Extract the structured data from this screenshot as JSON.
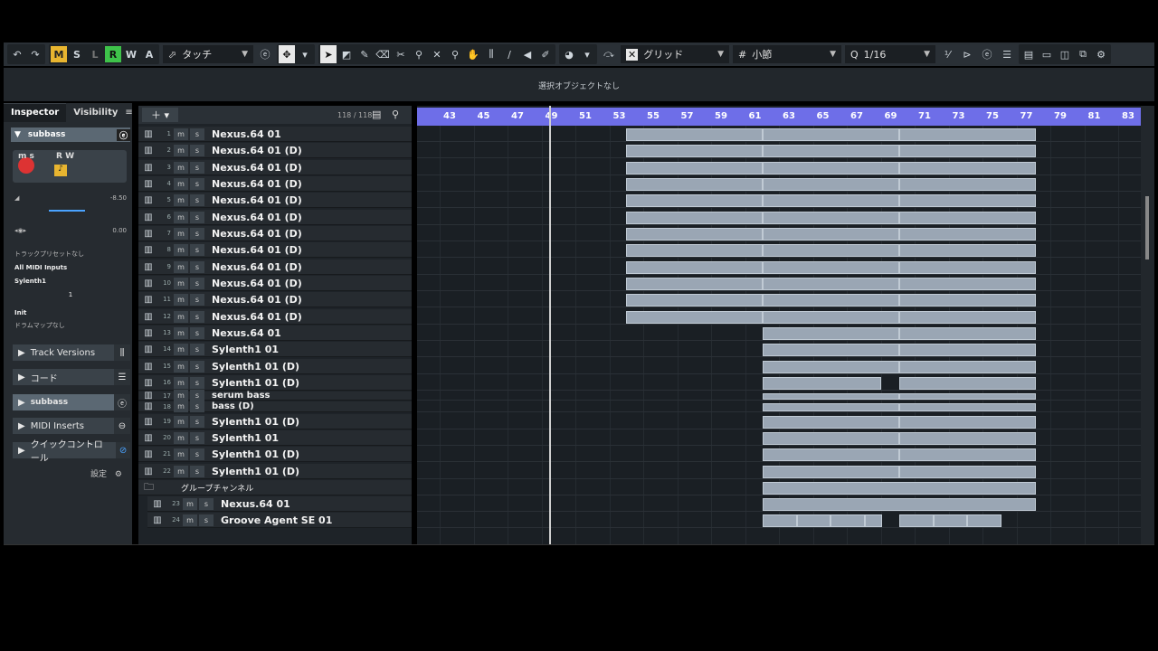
{
  "toolbar": {
    "undo_icon": "undo-icon",
    "redo_icon": "redo-icon",
    "mode_buttons": [
      "M",
      "S",
      "L",
      "R",
      "W",
      "A"
    ],
    "automation_mode": "タッチ",
    "snap_type": "グリッド",
    "grid_type": "小節",
    "quantize": "1/16",
    "colors": {
      "m_active": "#e8b530",
      "r_active": "#3ec24a",
      "accent": "#6e6ee8"
    }
  },
  "infobar": {
    "text": "選択オブジェクトなし"
  },
  "inspector": {
    "tabs": [
      "Inspector",
      "Visibility"
    ],
    "track_name": "subbass",
    "volume": "-8.50",
    "pan": "0.00",
    "preset": "トラックプリセットなし",
    "input": "All MIDI Inputs",
    "output": "Sylenth1",
    "channel": "1",
    "program": "Init",
    "drum_map": "ドラムマップなし",
    "sections": [
      "Track Versions",
      "コード",
      "subbass",
      "MIDI Inserts",
      "クイックコントロール"
    ],
    "settings": "設定"
  },
  "tracklist": {
    "count": "118 / 118",
    "tracks": [
      {
        "num": "1",
        "name": "Nexus.64 01"
      },
      {
        "num": "2",
        "name": "Nexus.64 01 (D)"
      },
      {
        "num": "3",
        "name": "Nexus.64 01 (D)"
      },
      {
        "num": "4",
        "name": "Nexus.64 01 (D)"
      },
      {
        "num": "5",
        "name": "Nexus.64 01 (D)"
      },
      {
        "num": "6",
        "name": "Nexus.64 01 (D)"
      },
      {
        "num": "7",
        "name": "Nexus.64 01 (D)"
      },
      {
        "num": "8",
        "name": "Nexus.64 01 (D)"
      },
      {
        "num": "9",
        "name": "Nexus.64 01 (D)"
      },
      {
        "num": "10",
        "name": "Nexus.64 01 (D)"
      },
      {
        "num": "11",
        "name": "Nexus.64 01 (D)"
      },
      {
        "num": "12",
        "name": "Nexus.64 01 (D)"
      },
      {
        "num": "13",
        "name": "Nexus.64 01"
      },
      {
        "num": "14",
        "name": "Sylenth1 01"
      },
      {
        "num": "15",
        "name": "Sylenth1 01 (D)"
      },
      {
        "num": "16",
        "name": "Sylenth1 01 (D)"
      },
      {
        "num": "17",
        "name": "serum bass"
      },
      {
        "num": "18",
        "name": "bass (D)"
      },
      {
        "num": "19",
        "name": "Sylenth1 01 (D)"
      },
      {
        "num": "20",
        "name": "Sylenth1 01"
      },
      {
        "num": "21",
        "name": "Sylenth1 01 (D)"
      },
      {
        "num": "22",
        "name": "Sylenth1 01 (D)"
      }
    ],
    "folder": "グループチャンネル",
    "sub_tracks": [
      {
        "num": "23",
        "name": "Nexus.64 01"
      },
      {
        "num": "24",
        "name": "Groove Agent SE 01"
      }
    ]
  },
  "ruler": {
    "bars": [
      "43",
      "45",
      "47",
      "49",
      "51",
      "53",
      "55",
      "57",
      "59",
      "61",
      "63",
      "65",
      "67",
      "69",
      "71",
      "73",
      "75",
      "77",
      "79",
      "81",
      "83"
    ]
  }
}
